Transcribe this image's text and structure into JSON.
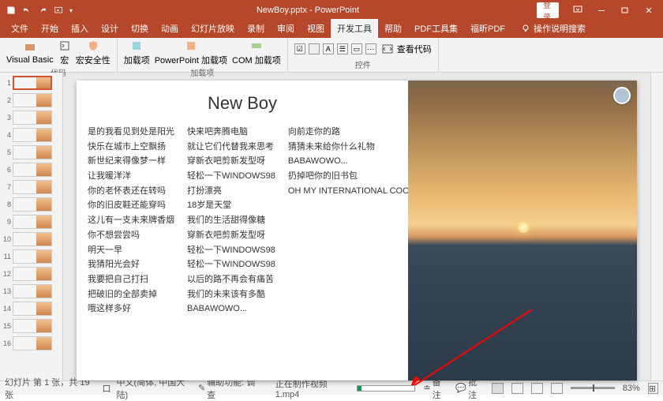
{
  "titlebar": {
    "filename": "NewBoy.pptx",
    "app": "PowerPoint",
    "login": "登录"
  },
  "tabs": {
    "file": "文件",
    "home": "开始",
    "insert": "插入",
    "design": "设计",
    "transitions": "切换",
    "animations": "动画",
    "slideshow": "幻灯片放映",
    "record": "录制",
    "review": "审阅",
    "view": "视图",
    "developer": "开发工具",
    "help": "帮助",
    "pdf1": "PDF工具集",
    "pdf2": "福昕PDF",
    "tell_me": "操作说明搜索"
  },
  "ribbon": {
    "vb": "Visual Basic",
    "macros": "宏",
    "macro_security": "宏安全性",
    "addins": "加载项",
    "ppt_addins": "PowerPoint 加载项",
    "com_addins": "COM 加载项",
    "view_code": "查看代码",
    "group_code": "代码",
    "group_addins": "加载项",
    "group_controls": "控件"
  },
  "slide": {
    "title": "New Boy",
    "col1": "是的我看见到处是阳光\n快乐在城市上空飘扬\n新世纪来得像梦一样\n让我暖洋洋\n你的老怀表还在转吗\n你的旧皮鞋还能穿吗\n这儿有一支未来牌香烟\n你不想尝尝吗\n明天一早\n我猜阳光会好\n我要把自己打扫\n把破旧的全部卖掉\n哦这样多好",
    "col2": "快来吧奔腾电脑\n就让它们代替我来思考\n穿新衣吧剪新发型呀\n轻松一下WINDOWS98\n打扮漂亮\n18岁是天堂\n我们的生活甜得像糖\n穿新衣吧剪新发型呀\n轻松一下WINDOWS98\n轻松一下WINDOWS98\n以后的路不再会有痛苦\n我们的未来该有多酷\nBABAWOWO...",
    "col3": "向前走你的路\n猜猜未来给你什么礼物\nBABAWOWO...\n扔掉吧你的旧书包\nOH MY INTERNATIONAL COOL PLAY BOY"
  },
  "status": {
    "slide_info": "幻灯片 第 1 张，共 19 张",
    "lang_icon": "口",
    "lang": "中文(简体, 中国大陆)",
    "access": "辅助功能: 调查",
    "video": "正在制作视频 1.mp4",
    "notes": "备注",
    "comments": "批注",
    "zoom": "83%"
  },
  "thumbs": {
    "count": 16
  }
}
